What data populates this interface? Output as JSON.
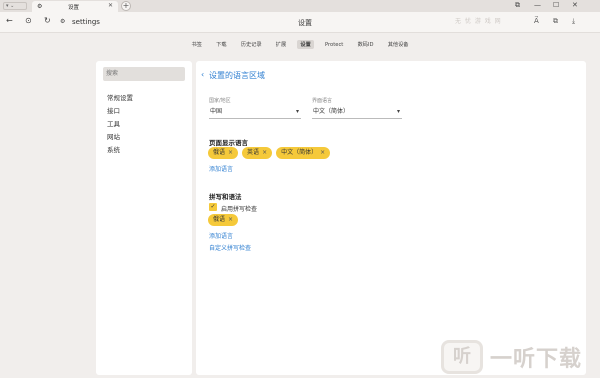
{
  "browser": {
    "tab": {
      "title": "设置",
      "favicon": "gear-icon"
    },
    "new_tab_symbol": "+",
    "address": "settings",
    "page_title": "设置",
    "window_controls": [
      "—",
      "☐",
      "✕"
    ]
  },
  "settings_tabs": [
    {
      "label": "书签",
      "active": false
    },
    {
      "label": "下载",
      "active": false
    },
    {
      "label": "历史记录",
      "active": false
    },
    {
      "label": "扩展",
      "active": false
    },
    {
      "label": "设置",
      "active": true
    },
    {
      "label": "Protect",
      "active": false
    },
    {
      "label": "数码ID",
      "active": false
    },
    {
      "label": "其他设备",
      "active": false
    }
  ],
  "sidebar": {
    "search_placeholder": "搜索",
    "items": [
      "常规设置",
      "接口",
      "工具",
      "网站",
      "系统"
    ]
  },
  "main": {
    "back_symbol": "‹",
    "title": "设置的语言区域",
    "region_label": "国家/地区",
    "region_value": "中国",
    "ui_lang_label": "界面语言",
    "ui_lang_value": "中文（简体）",
    "display_heading": "页面显示语言",
    "display_langs": [
      "俄语",
      "英语",
      "中文（简体）"
    ],
    "add_lang": "添加语言",
    "spell_heading": "拼写和语法",
    "spell_check_label": "启用拼写检查",
    "spell_langs": [
      "俄语"
    ],
    "add_lang2": "添加语言",
    "custom_spell": "自定义拼写检查"
  },
  "watermark": {
    "logo_char": "听",
    "text": "一听下载",
    "top_right": "无 忧 游 戏 网"
  },
  "colors": {
    "accent": "#2f7fd1",
    "chip": "#f5c93a"
  }
}
